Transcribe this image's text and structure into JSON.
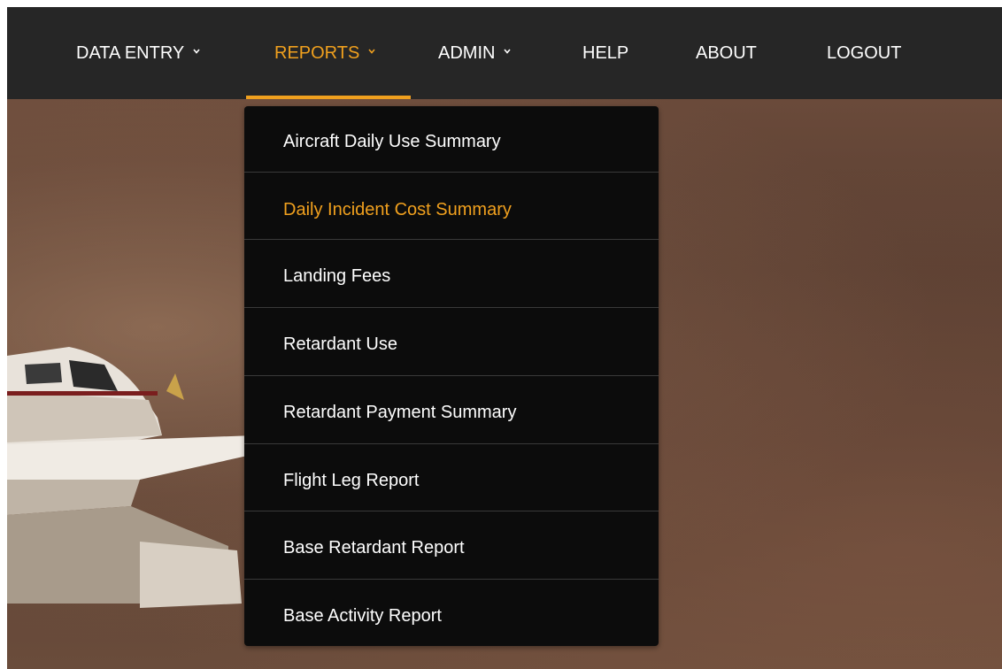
{
  "nav": {
    "items": [
      {
        "label": "DATA ENTRY",
        "has_dropdown": true,
        "active": false
      },
      {
        "label": "REPORTS",
        "has_dropdown": true,
        "active": true
      },
      {
        "label": "ADMIN",
        "has_dropdown": true,
        "active": false
      },
      {
        "label": "HELP",
        "has_dropdown": false,
        "active": false
      },
      {
        "label": "ABOUT",
        "has_dropdown": false,
        "active": false
      },
      {
        "label": "LOGOUT",
        "has_dropdown": false,
        "active": false
      }
    ]
  },
  "reports_menu": {
    "items": [
      {
        "label": "Aircraft Daily Use Summary",
        "active": false
      },
      {
        "label": "Daily Incident Cost Summary",
        "active": true
      },
      {
        "label": "Landing Fees",
        "active": false
      },
      {
        "label": "Retardant Use",
        "active": false
      },
      {
        "label": "Retardant Payment Summary",
        "active": false
      },
      {
        "label": "Flight Leg Report",
        "active": false
      },
      {
        "label": "Base Retardant Report",
        "active": false
      },
      {
        "label": "Base Activity Report",
        "active": false
      }
    ]
  },
  "icons": {
    "dropdown_indicator": "chevron-down-icon"
  },
  "colors": {
    "navbar_bg": "#262626",
    "accent": "#f0a01e",
    "dropdown_bg": "#0c0c0c",
    "text": "#ffffff"
  }
}
